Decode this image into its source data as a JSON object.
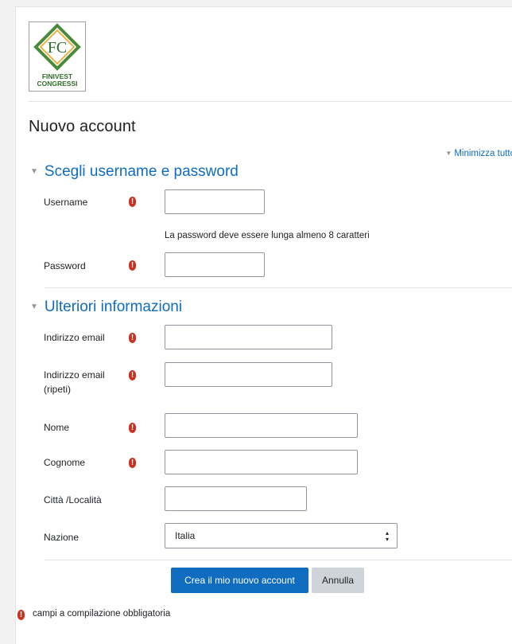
{
  "logo": {
    "line1": "FINIVEST",
    "line2": "CONGRESSI",
    "monogram": "FC",
    "colors": {
      "diamond": "#4a8a3c",
      "text": "#2f6e2a"
    }
  },
  "page_title": "Nuovo account",
  "collapse_all": "Minimizza tutto",
  "section1": {
    "title": "Scegli username e password",
    "username": {
      "label": "Username",
      "value": "",
      "placeholder": ""
    },
    "password_hint": "La password deve essere lunga almeno 8 caratteri",
    "password": {
      "label": "Password",
      "value": "",
      "placeholder": ""
    }
  },
  "section2": {
    "title": "Ulteriori informazioni",
    "email": {
      "label": "Indirizzo email",
      "value": ""
    },
    "email2": {
      "label_line1": "Indirizzo email",
      "label_line2": "(ripeti)",
      "value": ""
    },
    "firstname": {
      "label": "Nome",
      "value": ""
    },
    "lastname": {
      "label": "Cognome",
      "value": ""
    },
    "city": {
      "label": "Città /Località",
      "value": ""
    },
    "country": {
      "label": "Nazione",
      "selected": "Italia"
    }
  },
  "buttons": {
    "submit": "Crea il mio nuovo account",
    "cancel": "Annulla"
  },
  "required_legend": "campi a compilazione obbligatoria",
  "icons": {
    "required": "exclamation-circle-icon",
    "collapse": "caret-down-icon",
    "select": "sort-arrows-icon"
  },
  "theme": {
    "primary": "#0f6cbf",
    "required": "#ca3120"
  }
}
